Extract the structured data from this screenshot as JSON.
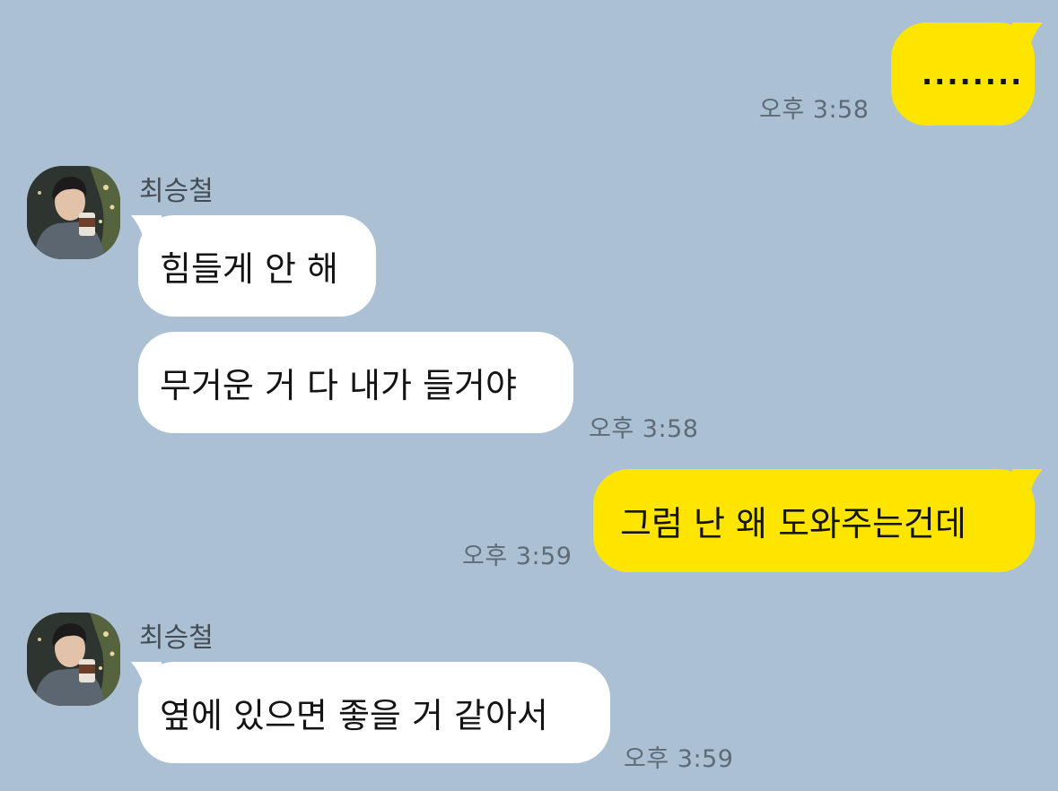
{
  "chat": {
    "messages": [
      {
        "id": "m1",
        "direction": "outgoing",
        "text": "........",
        "time": "오후 3:58"
      },
      {
        "id": "m2",
        "direction": "incoming",
        "sender": "최승철",
        "avatar_icon": "profile-photo-avatar",
        "text": "힘들게 안 해"
      },
      {
        "id": "m3",
        "direction": "incoming",
        "text": "무거운 거 다 내가 들거야",
        "time": "오후 3:58"
      },
      {
        "id": "m4",
        "direction": "outgoing",
        "text": "그럼 난 왜 도와주는건데",
        "time": "오후 3:59"
      },
      {
        "id": "m5",
        "direction": "incoming",
        "sender": "최승철",
        "avatar_icon": "profile-photo-avatar",
        "text": "옆에 있으면 좋을 거 같아서",
        "time": "오후 3:59"
      }
    ]
  },
  "colors": {
    "background": "#abc1d3",
    "outgoing_bubble": "#fee500",
    "incoming_bubble": "#ffffff",
    "timestamp": "#5d6b78",
    "sender_name": "#434c55"
  }
}
